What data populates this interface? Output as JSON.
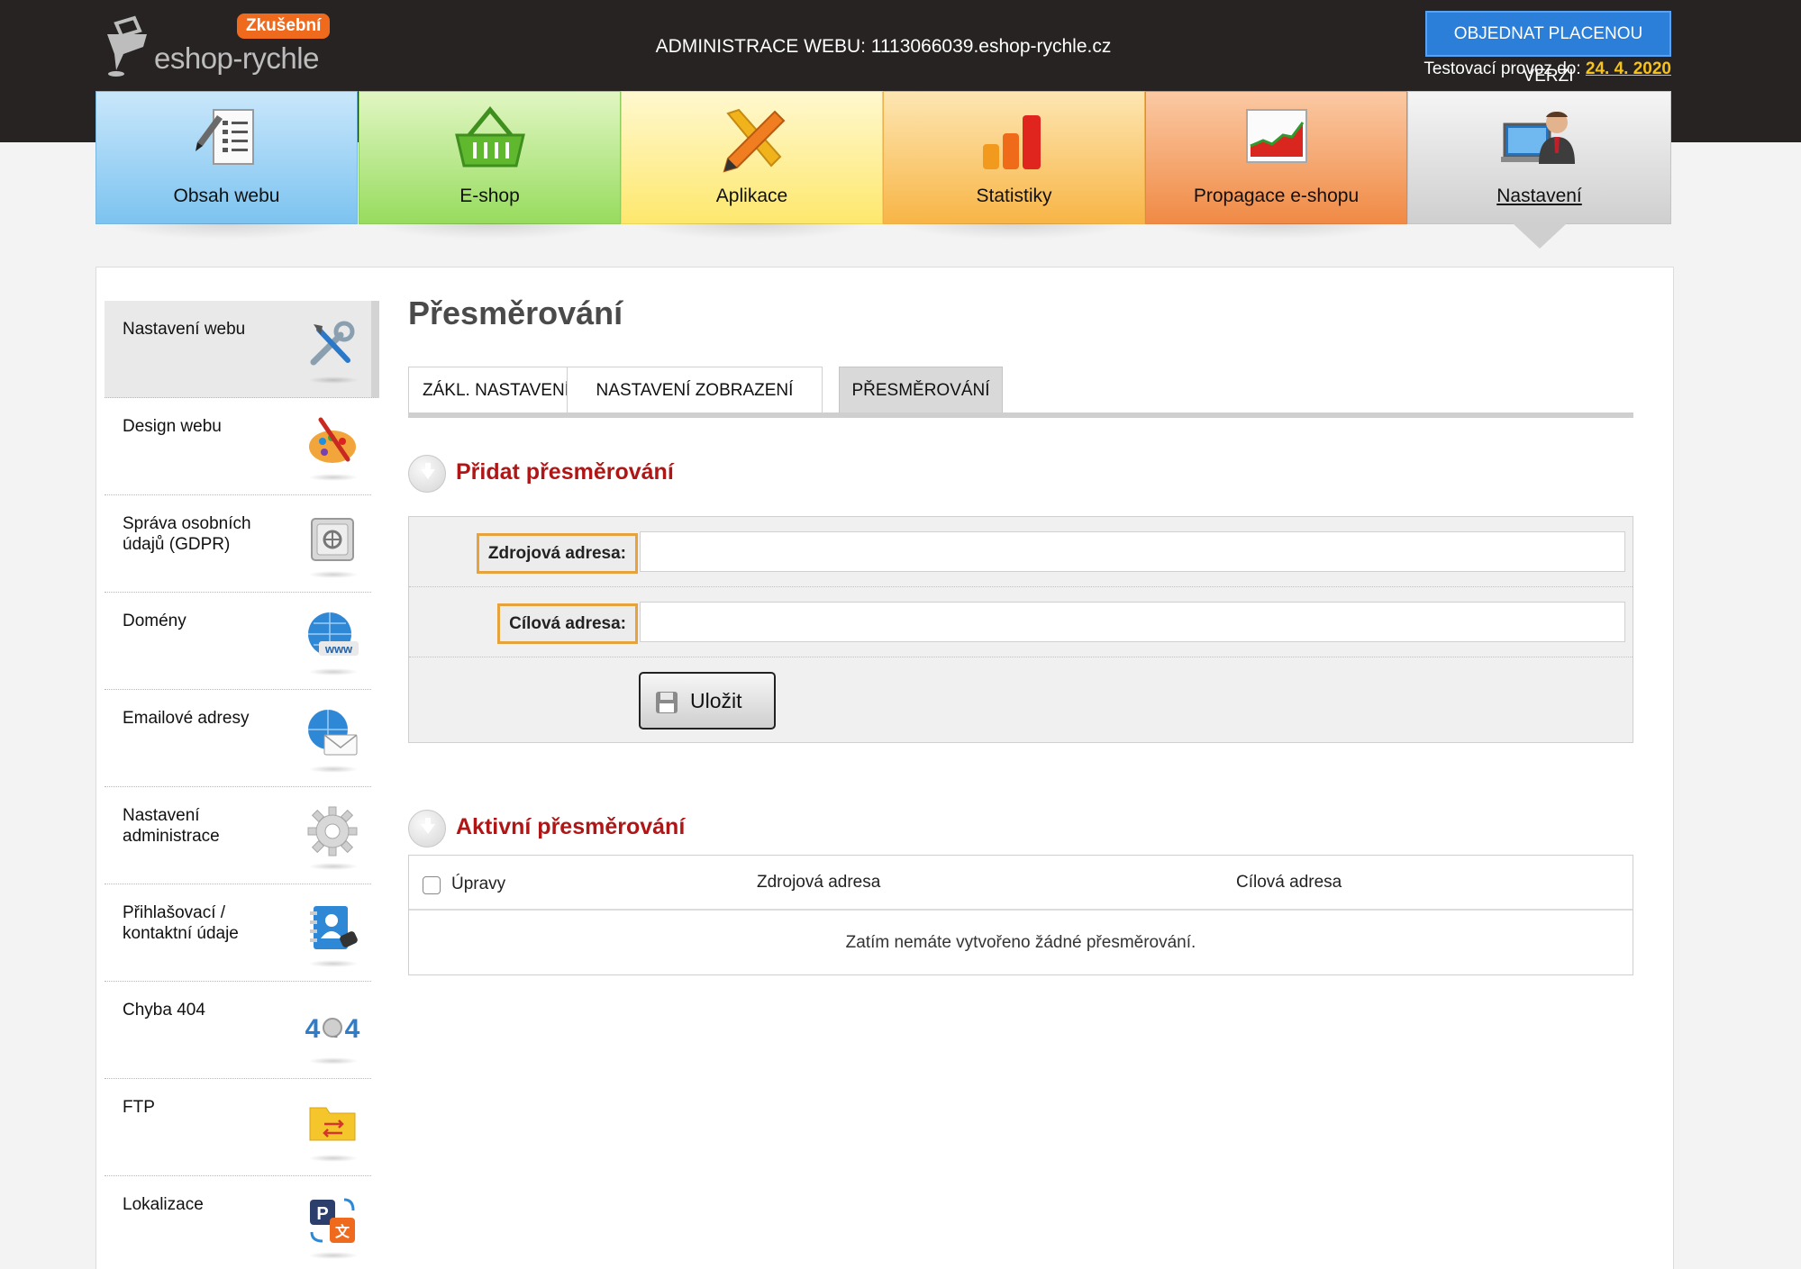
{
  "header": {
    "logo_text": "eshop-rychle",
    "badge": "Zkušební",
    "admin_title": "ADMINISTRACE WEBU: 1113066039.eshop-rychle.cz",
    "order_button": "OBJEDNAT PLACENOU VERZI",
    "trial_label": "Testovací provoz do:",
    "trial_date": "24. 4. 2020"
  },
  "nav": [
    {
      "label": "Obsah webu",
      "icon": "document-pen-icon"
    },
    {
      "label": "E-shop",
      "icon": "basket-icon"
    },
    {
      "label": "Aplikace",
      "icon": "pencil-ruler-icon"
    },
    {
      "label": "Statistiky",
      "icon": "bar-chart-icon"
    },
    {
      "label": "Propagace e-shopu",
      "icon": "growth-chart-icon"
    },
    {
      "label": "Nastavení",
      "icon": "admin-user-icon",
      "active": true
    }
  ],
  "sidebar": [
    {
      "label": "Nastavení webu",
      "icon": "tools-icon",
      "active": true
    },
    {
      "label": "Design webu",
      "icon": "palette-icon"
    },
    {
      "label": "Správa osobních údajů (GDPR)",
      "icon": "safe-icon"
    },
    {
      "label": "Domény",
      "icon": "www-globe-icon"
    },
    {
      "label": "Emailové adresy",
      "icon": "email-globe-icon"
    },
    {
      "label": "Nastavení administrace",
      "icon": "gear-icon"
    },
    {
      "label": "Přihlašovací / kontaktní údaje",
      "icon": "contacts-icon"
    },
    {
      "label": "Chyba 404",
      "icon": "error-404-icon"
    },
    {
      "label": "FTP",
      "icon": "ftp-folder-icon"
    },
    {
      "label": "Lokalizace",
      "icon": "localization-icon"
    }
  ],
  "main": {
    "title": "Přesměrování",
    "tabs": [
      {
        "label": "ZÁKL. NASTAVENÍ"
      },
      {
        "label": "NASTAVENÍ ZOBRAZENÍ"
      },
      {
        "label": "PŘESMĚROVÁNÍ",
        "active": true
      }
    ],
    "add_section": {
      "title": "Přidat přesměrování",
      "source_label": "Zdrojová adresa:",
      "source_value": "",
      "target_label": "Cílová adresa:",
      "target_value": "",
      "save_label": "Uložit"
    },
    "active_section": {
      "title": "Aktivní přesměrování",
      "columns": [
        "Úpravy",
        "Zdrojová adresa",
        "Cílová adresa"
      ],
      "empty_message": "Zatím nemáte vytvořeno žádné přesměrování."
    }
  },
  "colors": {
    "header_bg": "#262322",
    "accent_red": "#b01616",
    "order_blue": "#2b7fd9",
    "badge_orange": "#ef6a1d",
    "label_border": "#e6a23c"
  }
}
